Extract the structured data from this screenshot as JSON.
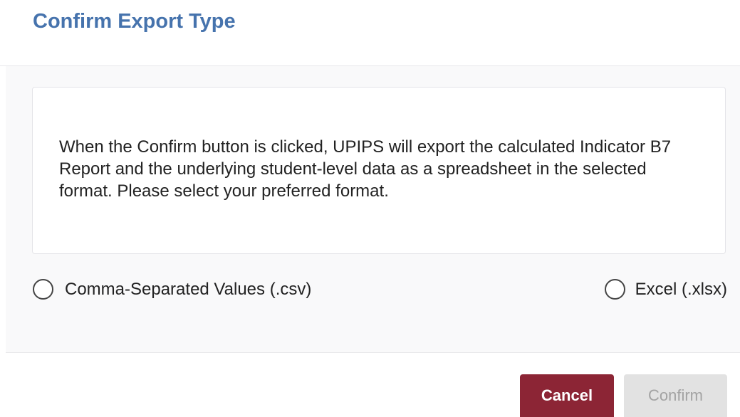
{
  "dialog": {
    "title": "Confirm Export Type",
    "message": "When the Confirm button is clicked, UPIPS will export the calculated Indicator B7 Report and the underlying student-level data as a spreadsheet in the selected format. Please select your preferred format.",
    "options": [
      {
        "label": "Comma-Separated Values (.csv)",
        "selected": false
      },
      {
        "label": "Excel (.xlsx)",
        "selected": false
      }
    ],
    "buttons": {
      "cancel": "Cancel",
      "confirm": "Confirm",
      "confirm_disabled": true
    },
    "colors": {
      "title": "#4673ad",
      "cancel_bg": "#8c2535",
      "confirm_disabled_bg": "#e2e2e2"
    }
  }
}
